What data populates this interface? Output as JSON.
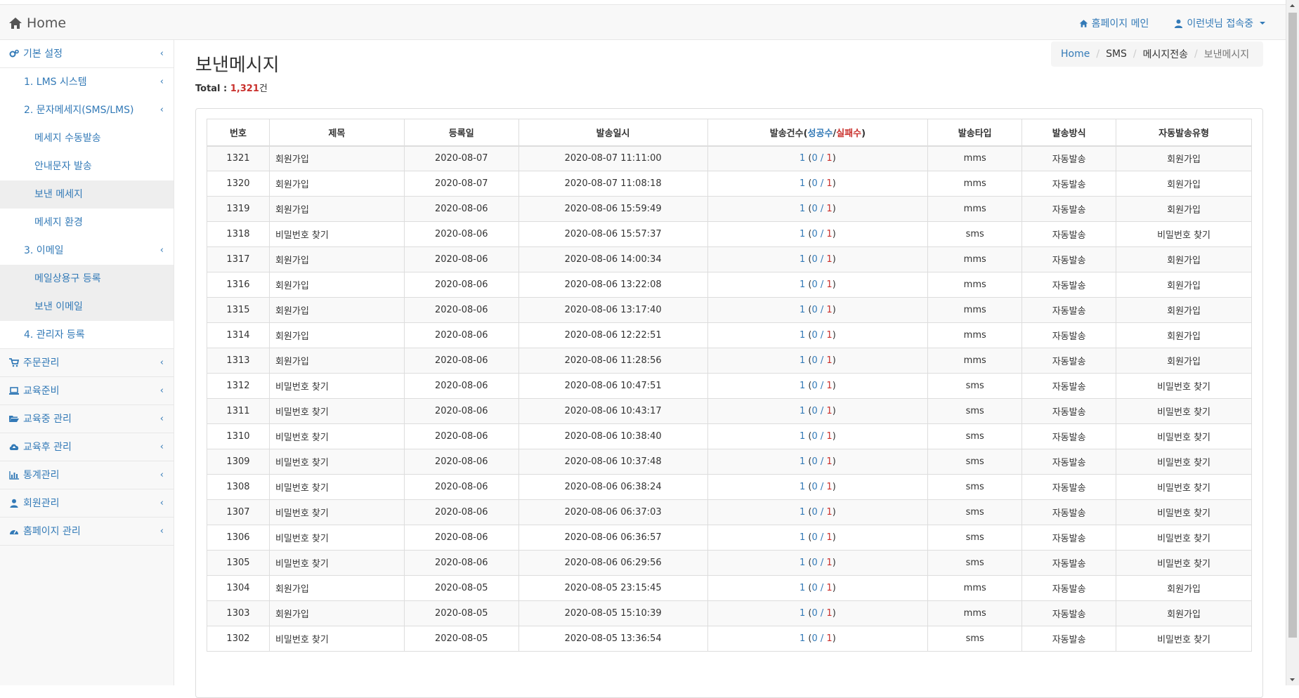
{
  "navbar": {
    "brand": "Home",
    "homepage_link": "홈페이지 메인",
    "user_menu": "이런넷님 접속중"
  },
  "sidebar": {
    "basic": "기본 설정",
    "lms": "1. LMS 시스템",
    "sms": "2. 문자메세지(SMS/LMS)",
    "manual_send": "메세지 수동발송",
    "notice_send": "안내문자 발송",
    "sent_msg": "보낸 메세지",
    "msg_env": "메세지 환경",
    "email": "3. 이메일",
    "mail_phrase": "메일상용구 등록",
    "sent_email": "보낸 이메일",
    "admin_reg": "4. 관리자 등록",
    "order": "주문관리",
    "edu_prep": "교육준비",
    "edu_during": "교육중 관리",
    "edu_after": "교육후 관리",
    "stats": "통계관리",
    "members": "회원관리",
    "homepage": "홈페이지 관리"
  },
  "page": {
    "title": "보낸메시지",
    "total_label": "Total :",
    "total_value": "1,321",
    "total_unit": "건"
  },
  "breadcrumb": {
    "home": "Home",
    "sms": "SMS",
    "send": "메시지전송",
    "current": "보낸메시지"
  },
  "table": {
    "headers": {
      "no": "번호",
      "subject": "제목",
      "reg_date": "등록일",
      "send_date": "발송일시",
      "count_prefix": "발송건수(",
      "count_ok": "성공수",
      "count_slash": "/",
      "count_fail": "실패수",
      "count_suffix": ")",
      "type": "발송타입",
      "method": "발송방식",
      "auto_type": "자동발송유형"
    },
    "rows": [
      {
        "no": "1321",
        "subject": "회원가입",
        "reg": "2020-08-07",
        "sent": "2020-08-07 11:11:00",
        "total": "1",
        "ok": "0",
        "fail": "1",
        "type": "mms",
        "method": "자동발송",
        "auto": "회원가입"
      },
      {
        "no": "1320",
        "subject": "회원가입",
        "reg": "2020-08-07",
        "sent": "2020-08-07 11:08:18",
        "total": "1",
        "ok": "0",
        "fail": "1",
        "type": "mms",
        "method": "자동발송",
        "auto": "회원가입"
      },
      {
        "no": "1319",
        "subject": "회원가입",
        "reg": "2020-08-06",
        "sent": "2020-08-06 15:59:49",
        "total": "1",
        "ok": "0",
        "fail": "1",
        "type": "mms",
        "method": "자동발송",
        "auto": "회원가입"
      },
      {
        "no": "1318",
        "subject": "비밀번호 찾기",
        "reg": "2020-08-06",
        "sent": "2020-08-06 15:57:37",
        "total": "1",
        "ok": "0",
        "fail": "1",
        "type": "sms",
        "method": "자동발송",
        "auto": "비밀번호 찾기"
      },
      {
        "no": "1317",
        "subject": "회원가입",
        "reg": "2020-08-06",
        "sent": "2020-08-06 14:00:34",
        "total": "1",
        "ok": "0",
        "fail": "1",
        "type": "mms",
        "method": "자동발송",
        "auto": "회원가입"
      },
      {
        "no": "1316",
        "subject": "회원가입",
        "reg": "2020-08-06",
        "sent": "2020-08-06 13:22:08",
        "total": "1",
        "ok": "0",
        "fail": "1",
        "type": "mms",
        "method": "자동발송",
        "auto": "회원가입"
      },
      {
        "no": "1315",
        "subject": "회원가입",
        "reg": "2020-08-06",
        "sent": "2020-08-06 13:17:40",
        "total": "1",
        "ok": "0",
        "fail": "1",
        "type": "mms",
        "method": "자동발송",
        "auto": "회원가입"
      },
      {
        "no": "1314",
        "subject": "회원가입",
        "reg": "2020-08-06",
        "sent": "2020-08-06 12:22:51",
        "total": "1",
        "ok": "0",
        "fail": "1",
        "type": "mms",
        "method": "자동발송",
        "auto": "회원가입"
      },
      {
        "no": "1313",
        "subject": "회원가입",
        "reg": "2020-08-06",
        "sent": "2020-08-06 11:28:56",
        "total": "1",
        "ok": "0",
        "fail": "1",
        "type": "mms",
        "method": "자동발송",
        "auto": "회원가입"
      },
      {
        "no": "1312",
        "subject": "비밀번호 찾기",
        "reg": "2020-08-06",
        "sent": "2020-08-06 10:47:51",
        "total": "1",
        "ok": "0",
        "fail": "1",
        "type": "sms",
        "method": "자동발송",
        "auto": "비밀번호 찾기"
      },
      {
        "no": "1311",
        "subject": "비밀번호 찾기",
        "reg": "2020-08-06",
        "sent": "2020-08-06 10:43:17",
        "total": "1",
        "ok": "0",
        "fail": "1",
        "type": "sms",
        "method": "자동발송",
        "auto": "비밀번호 찾기"
      },
      {
        "no": "1310",
        "subject": "비밀번호 찾기",
        "reg": "2020-08-06",
        "sent": "2020-08-06 10:38:40",
        "total": "1",
        "ok": "0",
        "fail": "1",
        "type": "sms",
        "method": "자동발송",
        "auto": "비밀번호 찾기"
      },
      {
        "no": "1309",
        "subject": "비밀번호 찾기",
        "reg": "2020-08-06",
        "sent": "2020-08-06 10:37:48",
        "total": "1",
        "ok": "0",
        "fail": "1",
        "type": "sms",
        "method": "자동발송",
        "auto": "비밀번호 찾기"
      },
      {
        "no": "1308",
        "subject": "비밀번호 찾기",
        "reg": "2020-08-06",
        "sent": "2020-08-06 06:38:24",
        "total": "1",
        "ok": "0",
        "fail": "1",
        "type": "sms",
        "method": "자동발송",
        "auto": "비밀번호 찾기"
      },
      {
        "no": "1307",
        "subject": "비밀번호 찾기",
        "reg": "2020-08-06",
        "sent": "2020-08-06 06:37:03",
        "total": "1",
        "ok": "0",
        "fail": "1",
        "type": "sms",
        "method": "자동발송",
        "auto": "비밀번호 찾기"
      },
      {
        "no": "1306",
        "subject": "비밀번호 찾기",
        "reg": "2020-08-06",
        "sent": "2020-08-06 06:36:57",
        "total": "1",
        "ok": "0",
        "fail": "1",
        "type": "sms",
        "method": "자동발송",
        "auto": "비밀번호 찾기"
      },
      {
        "no": "1305",
        "subject": "비밀번호 찾기",
        "reg": "2020-08-06",
        "sent": "2020-08-06 06:29:56",
        "total": "1",
        "ok": "0",
        "fail": "1",
        "type": "sms",
        "method": "자동발송",
        "auto": "비밀번호 찾기"
      },
      {
        "no": "1304",
        "subject": "회원가입",
        "reg": "2020-08-05",
        "sent": "2020-08-05 23:15:45",
        "total": "1",
        "ok": "0",
        "fail": "1",
        "type": "mms",
        "method": "자동발송",
        "auto": "회원가입"
      },
      {
        "no": "1303",
        "subject": "회원가입",
        "reg": "2020-08-05",
        "sent": "2020-08-05 15:10:39",
        "total": "1",
        "ok": "0",
        "fail": "1",
        "type": "mms",
        "method": "자동발송",
        "auto": "회원가입"
      },
      {
        "no": "1302",
        "subject": "비밀번호 찾기",
        "reg": "2020-08-05",
        "sent": "2020-08-05 13:36:54",
        "total": "1",
        "ok": "0",
        "fail": "1",
        "type": "sms",
        "method": "자동발송",
        "auto": "비밀번호 찾기"
      }
    ]
  },
  "colors": {
    "link": "#337ab7",
    "fail": "#c9302c"
  }
}
